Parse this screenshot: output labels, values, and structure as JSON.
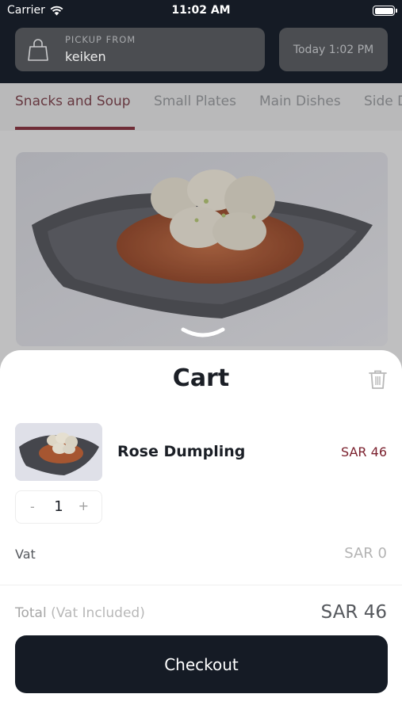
{
  "status_bar": {
    "carrier": "Carrier",
    "time": "11:02 AM"
  },
  "pickup": {
    "label": "PICKUP FROM",
    "location": "keiken"
  },
  "schedule": {
    "time": "Today 1:02 PM"
  },
  "tabs": [
    {
      "label": "Snacks and Soup",
      "active": true
    },
    {
      "label": "Small Plates",
      "active": false
    },
    {
      "label": "Main Dishes",
      "active": false
    },
    {
      "label": "Side D",
      "active": false
    }
  ],
  "cart": {
    "title": "Cart",
    "item": {
      "name": "Rose Dumpling",
      "price": "SAR 46",
      "quantity": "1",
      "minus": "-",
      "plus": "+"
    },
    "vat": {
      "label": "Vat",
      "value": "SAR 0"
    },
    "total": {
      "label": "Total",
      "note": "(Vat Included)",
      "value": "SAR 46"
    },
    "checkout_label": "Checkout"
  },
  "colors": {
    "dark": "#151b25",
    "accent": "#7a1f2c",
    "tab_underline": "#7a2a35"
  },
  "icons": [
    "wifi-icon",
    "battery-icon",
    "shopping-bag-icon",
    "chevron-down-icon",
    "trash-icon"
  ]
}
